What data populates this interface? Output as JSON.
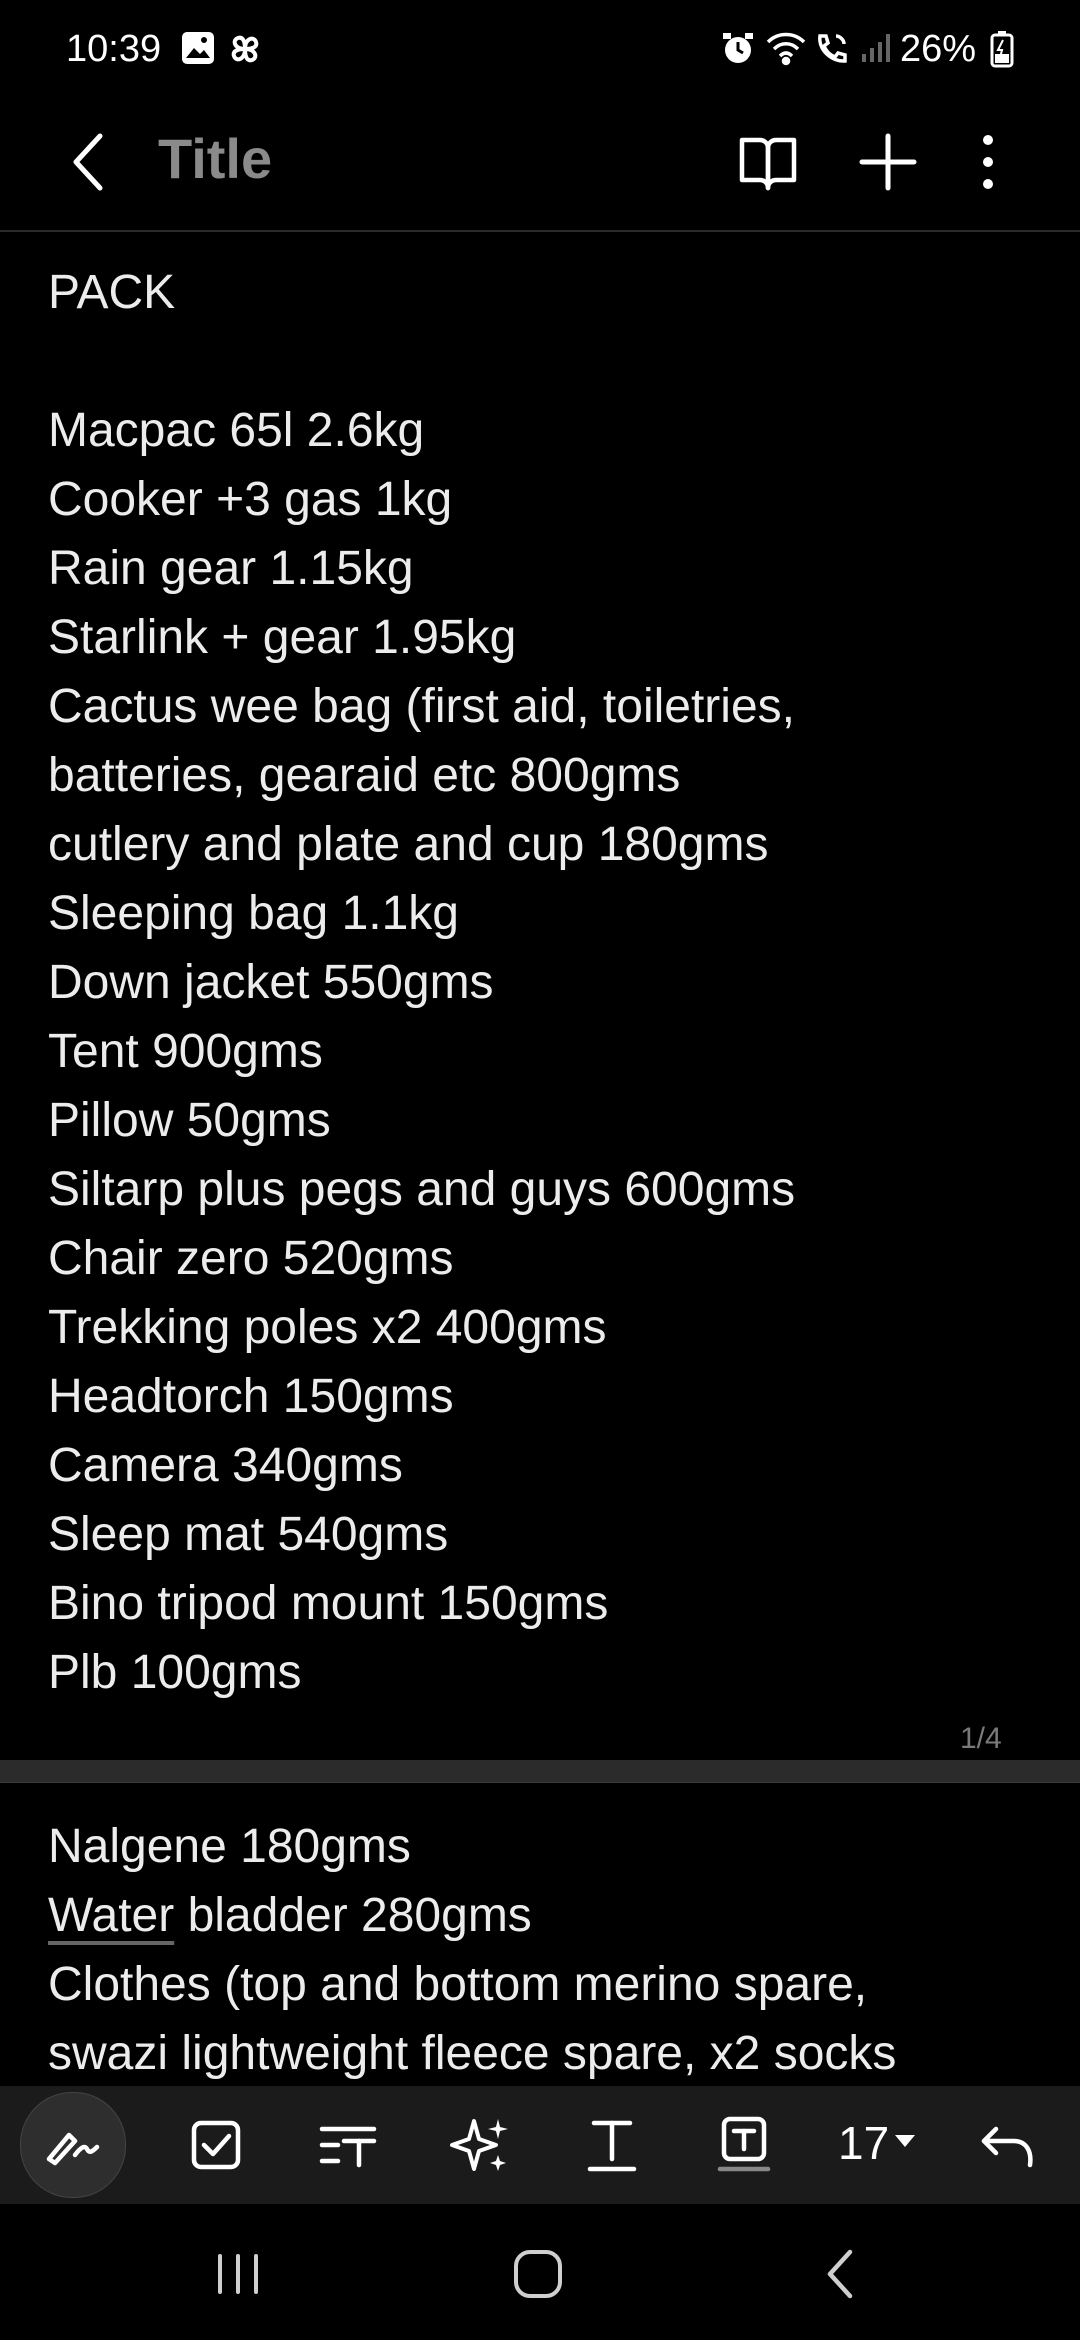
{
  "status_bar": {
    "time": "10:39",
    "battery": "26%",
    "icons": [
      "gallery-icon",
      "pinwheel-icon",
      "alarm-icon",
      "wifi-icon",
      "wifi-calling-icon",
      "signal-icon",
      "battery-icon"
    ]
  },
  "header": {
    "title": "Title",
    "icons": [
      "back-icon",
      "reading-mode-icon",
      "add-icon",
      "more-icon"
    ]
  },
  "note": {
    "page1_lines": [
      "PACK",
      "",
      "Macpac 65l 2.6kg",
      "Cooker +3 gas 1kg",
      "Rain gear 1.15kg",
      "Starlink + gear 1.95kg",
      "Cactus wee bag (first aid, toiletries,",
      "batteries, gearaid etc 800gms",
      "cutlery and plate and cup 180gms",
      "Sleeping bag 1.1kg",
      "Down jacket 550gms",
      "Tent 900gms",
      "Pillow 50gms",
      "Siltarp plus pegs and guys 600gms",
      "Chair zero 520gms",
      "Trekking poles x2 400gms",
      "Headtorch 150gms",
      "Camera 340gms",
      "Sleep mat 540gms",
      "Bino tripod mount 150gms",
      "Plb 100gms"
    ],
    "page_indicator": "1/4",
    "page2": {
      "line1": "Nalgene 180gms",
      "line2_underlined": "Water",
      "line2_rest": " bladder 280gms",
      "line3": "Clothes (top and bottom merino spare,",
      "line4": "swazi lightweight fleece spare, x2 socks"
    }
  },
  "toolbar": {
    "font_size": "17",
    "icons": [
      "pen-icon",
      "checkbox-icon",
      "text-style-icon",
      "ai-sparkle-icon",
      "text-format-icon",
      "text-box-icon",
      "font-size-dropdown-icon",
      "undo-icon"
    ]
  },
  "nav_bar": {
    "icons": [
      "recents-icon",
      "home-icon",
      "back-nav-icon"
    ]
  },
  "colors": {
    "background": "#000000",
    "text": "#ececec",
    "title": "#8a8a8a",
    "toolbar_bg": "#1b1b1b"
  }
}
